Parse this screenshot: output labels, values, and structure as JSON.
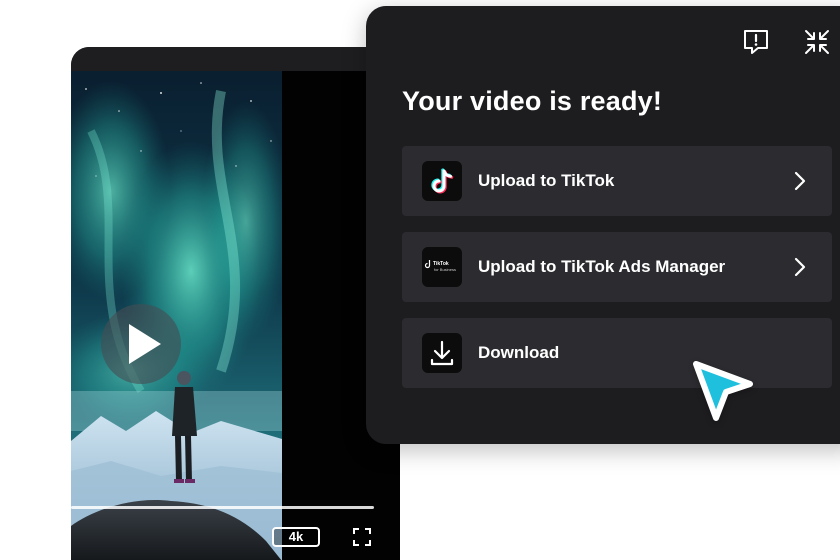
{
  "panel": {
    "title": "Your video is ready!",
    "options": [
      {
        "label": "Upload to TikTok",
        "icon": "tiktok-logo-icon",
        "has_chevron": true
      },
      {
        "label": "Upload to TikTok Ads Manager",
        "icon": "tiktok-for-business-logo-icon",
        "has_chevron": true
      },
      {
        "label": "Download",
        "icon": "download-icon",
        "has_chevron": false
      }
    ],
    "header_icons": [
      "feedback-icon",
      "minimize-icon"
    ]
  },
  "player": {
    "quality": "4k",
    "controls": [
      "play-icon",
      "fullscreen-icon"
    ],
    "progress": 0.0
  },
  "business_logo": {
    "text": "TikTok",
    "subtext": "for Business"
  },
  "colors": {
    "panel_bg": "#1d1d20",
    "option_bg": "#2c2c30",
    "cursor_fill": "#1ec0dd",
    "tiktok_cyan": "#25f4ee",
    "tiktok_red": "#fe2c55"
  }
}
